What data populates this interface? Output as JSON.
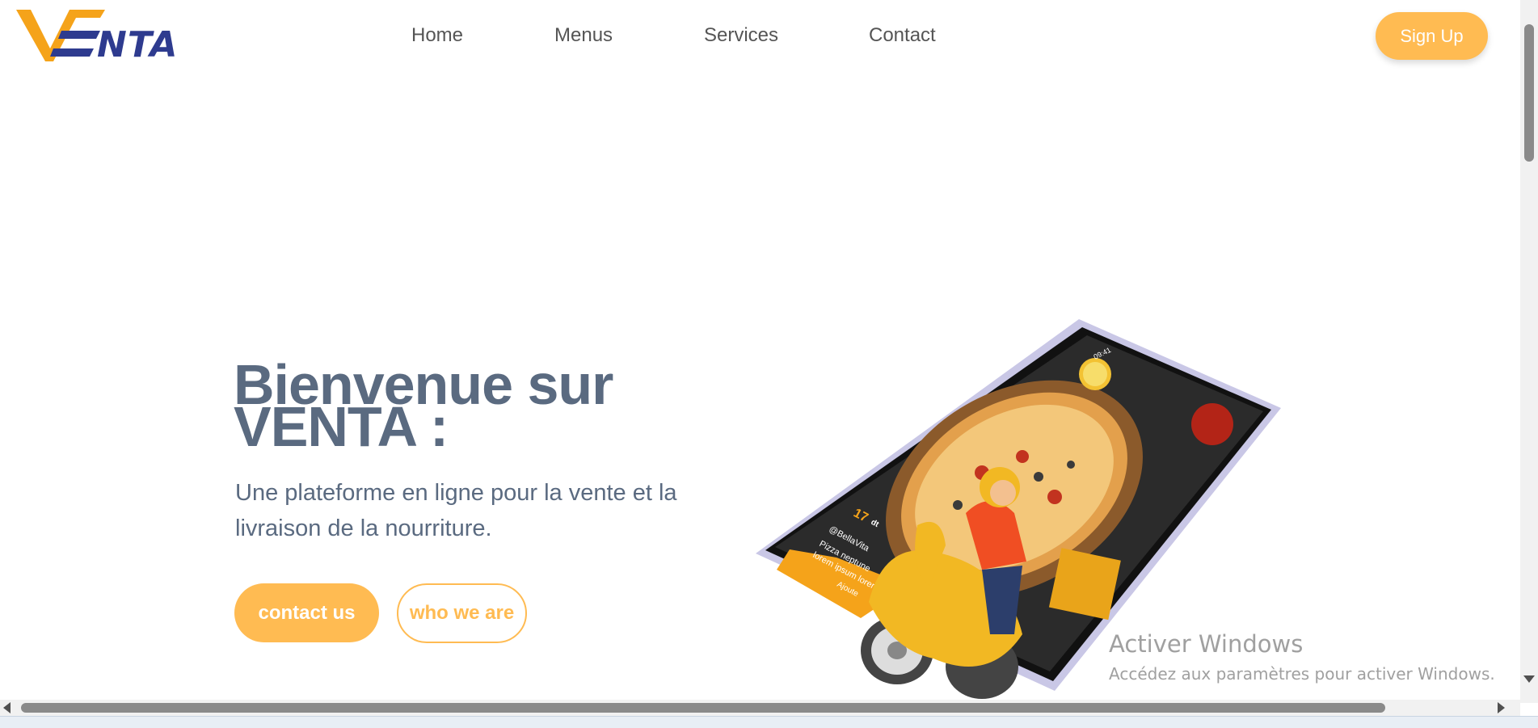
{
  "brand": {
    "logo_text": "NTA",
    "logo_letter": "V"
  },
  "nav": {
    "links": [
      "Home",
      "Menus",
      "Services",
      "Contact"
    ],
    "signup_label": "Sign Up"
  },
  "hero": {
    "title": "Bienvenue sur VENTA :",
    "subtitle": "Une plateforme en ligne pour la vente et la livraison de la nourriture.",
    "primary_button": "contact us",
    "secondary_button": "who we are"
  },
  "phone_screen": {
    "time": "09:41",
    "price": "17",
    "price_unit": "dt",
    "handle": "@BellaVita",
    "item_name": "Pizza neptune",
    "item_desc": "lorem ipsum lorem ipsum",
    "add_label": "Ajoute"
  },
  "watermark": {
    "title": "Activer Windows",
    "subtitle": "Accédez aux paramètres pour activer Windows."
  },
  "colors": {
    "accent": "#ffbb52",
    "brand_blue": "#2e3b8f",
    "brand_orange": "#f5a31a",
    "text_slate": "#5a6a80"
  }
}
